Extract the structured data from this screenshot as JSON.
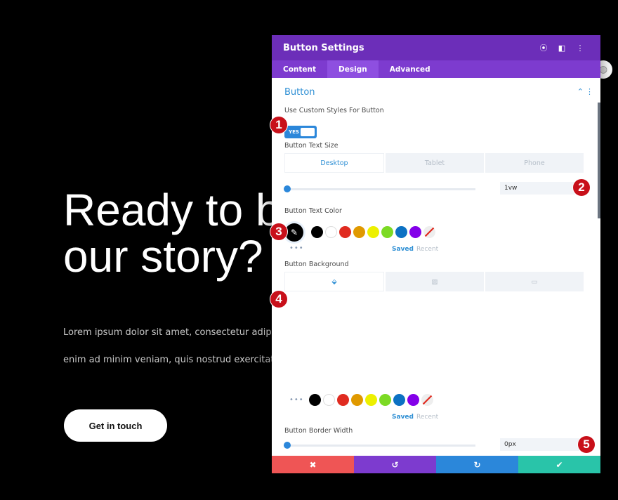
{
  "hero": {
    "title": "Ready to b\nour story?",
    "line1": "Lorem ipsum dolor sit amet, consectetur adipiscin",
    "line2": "enim ad minim veniam, quis nostrud exercitation u",
    "cta": "Get in touch"
  },
  "panel": {
    "title": "Button Settings",
    "header_icons": [
      "fullscreen-icon",
      "layout-icon",
      "more-icon"
    ],
    "tabs": [
      {
        "label": "Content"
      },
      {
        "label": "Design",
        "active": true
      },
      {
        "label": "Advanced"
      }
    ],
    "section": "Button",
    "custom_styles": {
      "label": "Use Custom Styles For Button",
      "value": "YES"
    },
    "text_size": {
      "label": "Button Text Size",
      "devices": [
        "Desktop",
        "Tablet",
        "Phone"
      ],
      "active_device": "Desktop",
      "value": "1vw"
    },
    "text_color": {
      "label": "Button Text Color",
      "selected": "#000000",
      "swatches": [
        "#000000",
        "#ffffff",
        "#e02b20",
        "#e09900",
        "#edf000",
        "#7cda24",
        "#0c71c3",
        "#8300e9"
      ],
      "saved": "Saved",
      "recent": "Recent"
    },
    "background": {
      "label": "Button Background",
      "tabs": [
        "color-icon",
        "gradient-icon",
        "image-icon"
      ],
      "swatches": [
        "#000000",
        "#ffffff",
        "#e02b20",
        "#e09900",
        "#edf000",
        "#7cda24",
        "#0c71c3",
        "#8300e9"
      ],
      "saved": "Saved",
      "recent": "Recent"
    },
    "border_width": {
      "label": "Button Border Width",
      "value": "0px"
    },
    "footer": {
      "colors": {
        "cancel": "#ef5555",
        "undo": "#7d3bcf",
        "redo": "#2b87da",
        "save": "#29c4a9"
      }
    }
  },
  "badges": [
    "1",
    "2",
    "3",
    "4",
    "5"
  ]
}
